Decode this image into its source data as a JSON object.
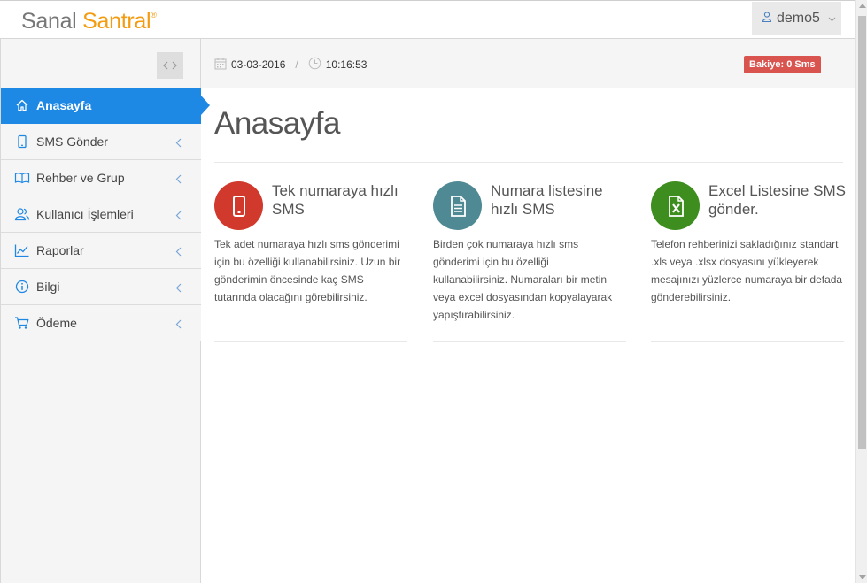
{
  "header": {
    "logo_part1": "Sanal",
    "logo_part2": "Santral",
    "logo_reg": "®",
    "user": "demo5"
  },
  "sidebar": {
    "items": [
      {
        "label": "Anasayfa",
        "icon": "home-icon",
        "active": true
      },
      {
        "label": "SMS Gönder",
        "icon": "mobile-icon"
      },
      {
        "label": "Rehber ve Grup",
        "icon": "book-icon"
      },
      {
        "label": "Kullanıcı İşlemleri",
        "icon": "users-icon"
      },
      {
        "label": "Raporlar",
        "icon": "chart-icon"
      },
      {
        "label": "Bilgi",
        "icon": "info-icon"
      },
      {
        "label": "Ödeme",
        "icon": "cart-icon"
      }
    ]
  },
  "strip": {
    "date": "03-03-2016",
    "separator": "/",
    "time": "10:16:53",
    "balance": "Bakiye: 0 Sms"
  },
  "main": {
    "title": "Anasayfa",
    "cards": [
      {
        "title": "Tek numaraya hızlı SMS",
        "desc": "Tek adet numaraya hızlı sms gönderimi için bu özelliği kullanabilirsiniz. Uzun bir gönderimin öncesinde kaç SMS tutarında olacağını görebilirsiniz.",
        "icon": "phone-icon",
        "color": "#d0392b"
      },
      {
        "title": "Numara listesine hızlı SMS",
        "desc": "Birden çok numaraya hızlı sms gönderimi için bu özelliği kullanabilirsiniz. Numaraları bir metin veya excel dosyasından kopyalayarak yapıştırabilirsiniz.",
        "icon": "document-icon",
        "color": "#4f8a94"
      },
      {
        "title": "Excel Listesine SMS gönder.",
        "desc": "Telefon rehberinizi sakladığınız standart .xls veya .xlsx dosyasını yükleyerek mesajınızı yüzlerce numaraya bir defada gönderebilirsiniz.",
        "icon": "excel-icon",
        "color": "#3e8e1f"
      }
    ]
  }
}
